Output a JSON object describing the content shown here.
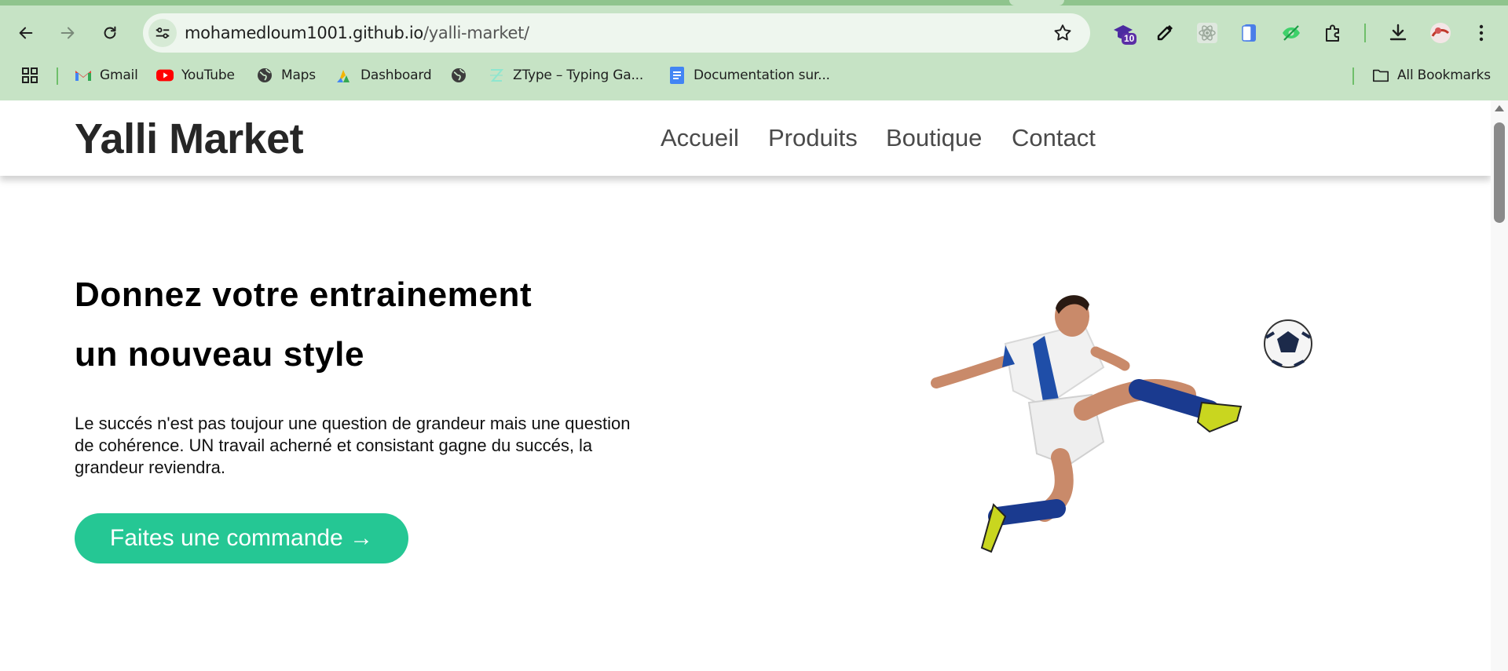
{
  "browser": {
    "url_host": "mohamedloum1001.github.io",
    "url_path": "/yalli-market/",
    "extension_badge": "10",
    "bookmarks": [
      {
        "label": "Gmail",
        "icon": "gmail-icon"
      },
      {
        "label": "YouTube",
        "icon": "youtube-icon"
      },
      {
        "label": "Maps",
        "icon": "globe-icon"
      },
      {
        "label": "Dashboard",
        "icon": "dashboard-icon"
      },
      {
        "label": "",
        "icon": "globe-icon"
      },
      {
        "label": "ZType – Typing Ga...",
        "icon": "ztype-icon"
      },
      {
        "label": "Documentation sur...",
        "icon": "docs-icon"
      }
    ],
    "all_bookmarks_label": "All Bookmarks"
  },
  "site": {
    "brand": "Yalli Market",
    "nav": [
      "Accueil",
      "Produits",
      "Boutique",
      "Contact"
    ]
  },
  "hero": {
    "title_line1": "Donnez votre entrainement",
    "title_line2": "un nouveau style",
    "text": "Le succés n'est pas toujour une question de grandeur mais une question de cohérence. UN travail acherné et consistant gagne du succés, la grandeur reviendra.",
    "cta": "Faites une commande →",
    "image": "soccer-player-kicking-ball"
  },
  "colors": {
    "chrome": "#c6e3c5",
    "accent": "#25c794",
    "brand_text": "#262626"
  }
}
